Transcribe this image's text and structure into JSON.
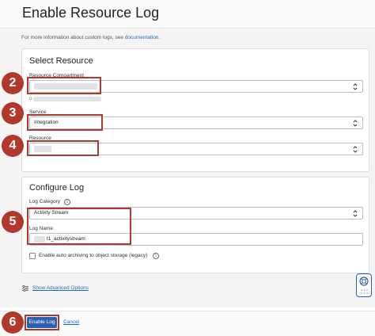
{
  "page": {
    "title": "Enable Resource Log",
    "info_text": "For more information about custom logs, see ",
    "info_link": "documentation",
    "info_end": "."
  },
  "select_resource": {
    "heading": "Select Resource",
    "compartment_label": "Resource Compartment",
    "compartment_sub": "o",
    "service_label": "Service",
    "service_value": "Integration",
    "resource_label": "Resource"
  },
  "configure_log": {
    "heading": "Configure Log",
    "category_label": "Log Category",
    "category_value": "Activity Stream",
    "name_label": "Log Name",
    "name_value": "t1_activitystream",
    "archive_label": "Enable auto archiving to object storage (legacy)",
    "info_glyph": "i"
  },
  "advanced": {
    "label": "Show Advanced Options"
  },
  "footer": {
    "enable_label": "Enable Log",
    "cancel_label": "Cancel"
  },
  "steps": [
    "2",
    "3",
    "4",
    "5",
    "6"
  ],
  "colors": {
    "accent": "#b0382d",
    "primary": "#2d5fae",
    "link": "#1f6fbf"
  },
  "icons": [
    "chevron-updown-icon",
    "info-icon",
    "sliders-icon",
    "lifebuoy-icon"
  ]
}
